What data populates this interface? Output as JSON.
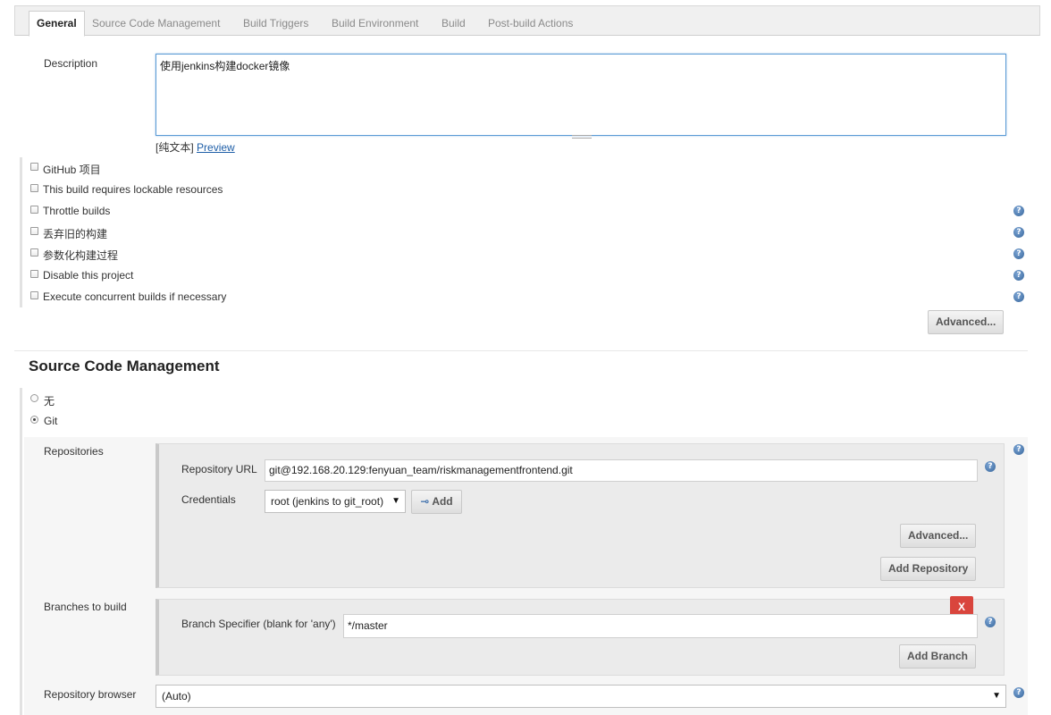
{
  "tabs": [
    "General",
    "Source Code Management",
    "Build Triggers",
    "Build Environment",
    "Build",
    "Post-build Actions"
  ],
  "general": {
    "description_label": "Description",
    "description_value": "使用jenkins构建docker镜像",
    "plain_text": "[纯文本]",
    "preview": "Preview",
    "options": [
      "GitHub 项目",
      "This build requires lockable resources",
      "Throttle builds",
      "丢弃旧的构建",
      "参数化构建过程",
      "Disable this project",
      "Execute concurrent builds if necessary"
    ],
    "advanced": "Advanced..."
  },
  "scm": {
    "heading": "Source Code Management",
    "none_label": "无",
    "git_label": "Git",
    "repositories_label": "Repositories",
    "repo_url_label": "Repository URL",
    "repo_url_value": "git@192.168.20.129:fenyuan_team/riskmanagementfrontend.git",
    "credentials_label": "Credentials",
    "credentials_value": "root (jenkins to git_root)",
    "add_label": "Add",
    "advanced": "Advanced...",
    "add_repository": "Add Repository",
    "branches_label": "Branches to build",
    "branch_specifier_label": "Branch Specifier (blank for 'any')",
    "branch_specifier_value": "*/master",
    "delete_branch": "X",
    "add_branch": "Add Branch",
    "repo_browser_label": "Repository browser",
    "repo_browser_value": "(Auto)"
  }
}
